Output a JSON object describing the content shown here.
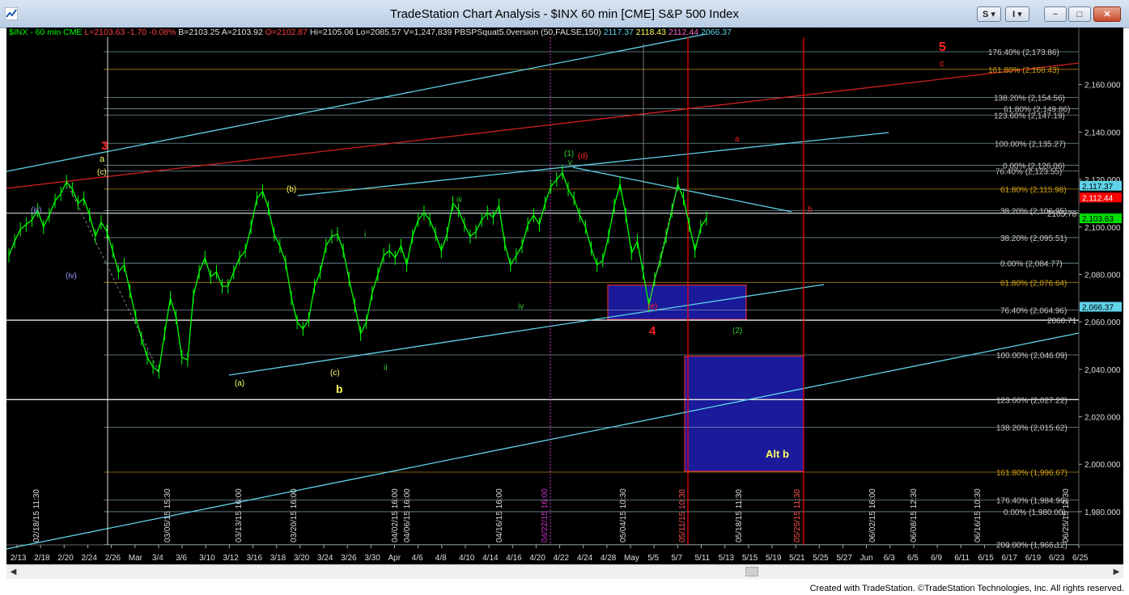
{
  "window": {
    "title": "TradeStation Chart Analysis - $INX 60 min [CME] S&P 500 Index",
    "controls": {
      "s_menu": "S",
      "i_menu": "I",
      "minimize": "−",
      "restore": "□",
      "close": "✕"
    }
  },
  "footer": {
    "copyright": "Created with TradeStation. ©TradeStation Technologies, Inc. All rights reserved."
  },
  "colors": {
    "background": "#000000",
    "price": "#00ff00",
    "channel": "#5fd3e8",
    "red": "#ff0000",
    "label_yellow": "#ffff66",
    "label_green": "#33cc33",
    "label_red": "#ff2020",
    "box_blue": "#1a1a9a",
    "fib_text": "#c8c8c8",
    "accent_magenta": "#cc33cc"
  },
  "chart_data": {
    "type": "line",
    "symbol": "$INX",
    "interval": "60 min",
    "header_items": [
      {
        "text": "$INX - 60 min  CME",
        "color": "#00ff00"
      },
      {
        "text": "L=2103.63",
        "color": "#ff4040"
      },
      {
        "text": "-1.70",
        "color": "#ff4040"
      },
      {
        "text": "-0.08%",
        "color": "#ff4040"
      },
      {
        "text": "B=2103.25",
        "color": "#e0e0e0"
      },
      {
        "text": "A=2103.92",
        "color": "#e0e0e0"
      },
      {
        "text": "O=2102.87",
        "color": "#ff4040"
      },
      {
        "text": "Hi=2105.06",
        "color": "#e0e0e0"
      },
      {
        "text": "Lo=2085.57",
        "color": "#e0e0e0"
      },
      {
        "text": "V=1,247,839",
        "color": "#e0e0e0"
      },
      {
        "text": "PBSPSquat5.0version (50,FALSE,150)",
        "color": "#e0e0e0"
      },
      {
        "text": "2117.37",
        "color": "#5fd3e8"
      },
      {
        "text": "2118.43",
        "color": "#ffff66"
      },
      {
        "text": "2112.44",
        "color": "#ff66cc"
      },
      {
        "text": "2066.37",
        "color": "#5fd3e8"
      }
    ],
    "ylim": [
      1966,
      2180
    ],
    "y_ticks": [
      1980,
      2000,
      2020,
      2040,
      2060,
      2080,
      2100,
      2120,
      2140,
      2160
    ],
    "x_tick_labels": [
      "2/13",
      "2/18",
      "2/20",
      "2/24",
      "2/26",
      "Mar",
      "3/4",
      "3/6",
      "3/10",
      "3/12",
      "3/16",
      "3/18",
      "3/20",
      "3/24",
      "3/26",
      "3/30",
      "Apr",
      "4/6",
      "4/8",
      "4/10",
      "4/14",
      "4/16",
      "4/20",
      "4/22",
      "4/24",
      "4/28",
      "May",
      "5/5",
      "5/7",
      "5/11",
      "5/13",
      "5/15",
      "5/19",
      "5/21",
      "5/25",
      "5/27",
      "Jun",
      "6/3",
      "6/5",
      "6/9",
      "6/11",
      "6/15",
      "6/17",
      "6/19",
      "6/23",
      "6/25"
    ],
    "series": [
      {
        "values": [
          2088,
          2094,
          2099,
          2101,
          2103,
          2107,
          2100,
          2105,
          2111,
          2114,
          2119,
          2116,
          2110,
          2112,
          2105,
          2096,
          2102,
          2098,
          2090,
          2081,
          2084,
          2073,
          2062,
          2053,
          2045,
          2041,
          2039,
          2055,
          2070,
          2062,
          2045,
          2044,
          2071,
          2081,
          2087,
          2079,
          2081,
          2075,
          2075,
          2081,
          2087,
          2090,
          2100,
          2112,
          2115,
          2108,
          2097,
          2092,
          2085,
          2070,
          2060,
          2057,
          2061,
          2075,
          2081,
          2092,
          2096,
          2097,
          2090,
          2078,
          2067,
          2055,
          2060,
          2072,
          2080,
          2088,
          2090,
          2087,
          2092,
          2084,
          2096,
          2103,
          2106,
          2103,
          2097,
          2090,
          2097,
          2110,
          2107,
          2101,
          2096,
          2098,
          2103,
          2106,
          2104,
          2109,
          2093,
          2084,
          2088,
          2092,
          2101,
          2105,
          2101,
          2110,
          2117,
          2120,
          2123,
          2116,
          2112,
          2105,
          2100,
          2091,
          2084,
          2086,
          2096,
          2109,
          2118,
          2105,
          2089,
          2094,
          2081,
          2067,
          2078,
          2086,
          2096,
          2107,
          2118,
          2112,
          2101,
          2090,
          2100,
          2103.63
        ]
      }
    ],
    "price_axis_boxes": [
      {
        "value": "2,117.37",
        "bg": "#5fd3e8",
        "fg": "#000000"
      },
      {
        "value": "2,112.44",
        "bg": "#ff0000",
        "fg": "#ffffff"
      },
      {
        "value": "2,103.63",
        "bg": "#00dd00",
        "fg": "#000000"
      },
      {
        "value": "2,066.37",
        "bg": "#5fd3e8",
        "fg": "#000000"
      }
    ],
    "fib_labels": [
      {
        "text": "176.40% (2,173.86)",
        "y": 2173.86
      },
      {
        "text": "161.80% (2,166.43)",
        "y": 2166.43,
        "color": "#d4a017"
      },
      {
        "text": "138.20% (2,154.56)",
        "y": 2154.56
      },
      {
        "text": "61.80% (2,149.86)",
        "y": 2149.86
      },
      {
        "text": "123.60% (2,147.19)",
        "y": 2147.19
      },
      {
        "text": "100.00% (2,135.27)",
        "y": 2135.27
      },
      {
        "text": "0.00% (2,126.06)",
        "y": 2126.06
      },
      {
        "text": "76.40% (2,123.55)",
        "y": 2123.55
      },
      {
        "text": "61.80% (2,115.98)",
        "y": 2115.98,
        "color": "#d4a017"
      },
      {
        "text": "38.20% (2,106.95)",
        "y": 2106.95
      },
      {
        "text": "2105.78",
        "y": 2105.78
      },
      {
        "text": "38.20% (2,095.51)",
        "y": 2095.51
      },
      {
        "text": "0.00% (2,084.77)",
        "y": 2084.77
      },
      {
        "text": "61.80% (2,076.64)",
        "y": 2076.64,
        "color": "#d4a017"
      },
      {
        "text": "76.40% (2,064.96)",
        "y": 2064.96
      },
      {
        "text": "2060.71",
        "y": 2060.71
      },
      {
        "text": "100.00% (2,046.09)",
        "y": 2046.09
      },
      {
        "text": "123.60% (2,027.22)",
        "y": 2027.22
      },
      {
        "text": "138.20% (2,015.62)",
        "y": 2015.62
      },
      {
        "text": "161.80% (1,996.67)",
        "y": 1996.67,
        "color": "#d4a017"
      },
      {
        "text": "176.40% (1,984.96)",
        "y": 1984.96
      },
      {
        "text": "0.00% (1,980.00)",
        "y": 1980.0
      },
      {
        "text": "200.00% (1,966.12)",
        "y": 1966.12
      }
    ],
    "wave_labels": [
      {
        "text": "3",
        "color": "#ff2020"
      },
      {
        "text": "a",
        "color": "#ffff66"
      },
      {
        "text": "(c)",
        "color": "#ffff66"
      },
      {
        "text": "(iii)",
        "color": "#9999ff"
      },
      {
        "text": "(iv)",
        "color": "#9999ff"
      },
      {
        "text": "(a)",
        "color": "#ffff66"
      },
      {
        "text": "(b)",
        "color": "#ffff66"
      },
      {
        "text": "(c)",
        "color": "#ffff66"
      },
      {
        "text": "b",
        "color": "#ffff66"
      },
      {
        "text": "i",
        "color": "#33cc33"
      },
      {
        "text": "ii",
        "color": "#33cc33"
      },
      {
        "text": "iii",
        "color": "#33cc33"
      },
      {
        "text": "iv",
        "color": "#33cc33"
      },
      {
        "text": "(1)",
        "color": "#33cc33"
      },
      {
        "text": "v",
        "color": "#33cc33"
      },
      {
        "text": "(d)",
        "color": "#ff2020"
      },
      {
        "text": "(e)",
        "color": "#ff2020"
      },
      {
        "text": "4",
        "color": "#ff2020"
      },
      {
        "text": "(2)",
        "color": "#33cc33"
      },
      {
        "text": "a",
        "color": "#ff2020"
      },
      {
        "text": "b",
        "color": "#ff2020"
      },
      {
        "text": "c",
        "color": "#ff2020"
      },
      {
        "text": "5",
        "color": "#ff2020"
      },
      {
        "text": "Alt b",
        "color": "#ffff66"
      }
    ],
    "time_markers": [
      "02/18/15 11:30",
      "03/05/15 15:30",
      "03/13/15 16:00",
      "03/20/15 16:00",
      "04/02/15 16:00",
      "04/06/15 16:00",
      "04/16/15 16:00",
      "04/22/15 16:00",
      "05/04/15 10:30",
      "05/11/15 10:30",
      "05/18/15 11:30",
      "05/25/15 11:30",
      "06/02/15 16:00",
      "06/08/15 12:30",
      "06/16/15 10:30",
      "06/25/15 12:30"
    ]
  }
}
